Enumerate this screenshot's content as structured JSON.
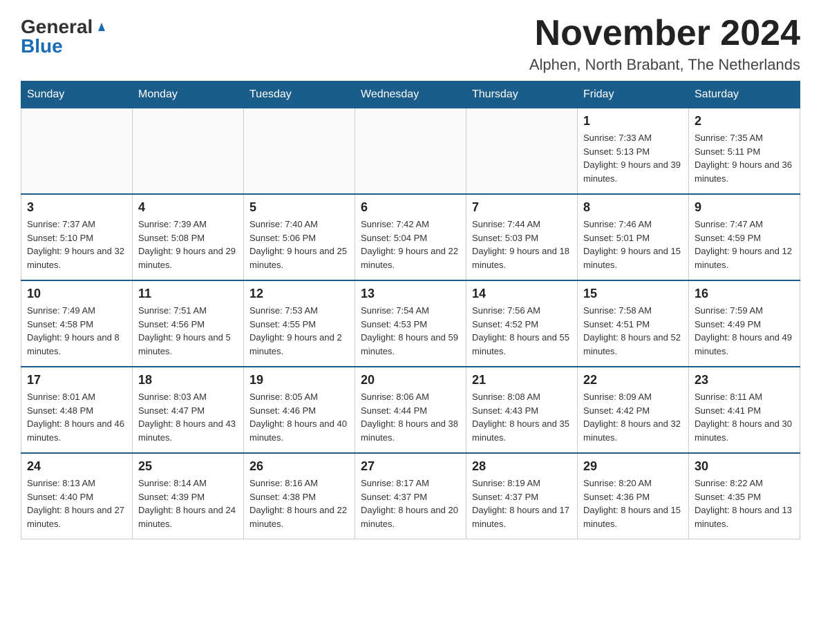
{
  "header": {
    "logo_general": "General",
    "logo_blue": "Blue",
    "month_title": "November 2024",
    "location": "Alphen, North Brabant, The Netherlands"
  },
  "days_of_week": [
    "Sunday",
    "Monday",
    "Tuesday",
    "Wednesday",
    "Thursday",
    "Friday",
    "Saturday"
  ],
  "weeks": [
    [
      {
        "day": "",
        "info": ""
      },
      {
        "day": "",
        "info": ""
      },
      {
        "day": "",
        "info": ""
      },
      {
        "day": "",
        "info": ""
      },
      {
        "day": "",
        "info": ""
      },
      {
        "day": "1",
        "info": "Sunrise: 7:33 AM\nSunset: 5:13 PM\nDaylight: 9 hours and 39 minutes."
      },
      {
        "day": "2",
        "info": "Sunrise: 7:35 AM\nSunset: 5:11 PM\nDaylight: 9 hours and 36 minutes."
      }
    ],
    [
      {
        "day": "3",
        "info": "Sunrise: 7:37 AM\nSunset: 5:10 PM\nDaylight: 9 hours and 32 minutes."
      },
      {
        "day": "4",
        "info": "Sunrise: 7:39 AM\nSunset: 5:08 PM\nDaylight: 9 hours and 29 minutes."
      },
      {
        "day": "5",
        "info": "Sunrise: 7:40 AM\nSunset: 5:06 PM\nDaylight: 9 hours and 25 minutes."
      },
      {
        "day": "6",
        "info": "Sunrise: 7:42 AM\nSunset: 5:04 PM\nDaylight: 9 hours and 22 minutes."
      },
      {
        "day": "7",
        "info": "Sunrise: 7:44 AM\nSunset: 5:03 PM\nDaylight: 9 hours and 18 minutes."
      },
      {
        "day": "8",
        "info": "Sunrise: 7:46 AM\nSunset: 5:01 PM\nDaylight: 9 hours and 15 minutes."
      },
      {
        "day": "9",
        "info": "Sunrise: 7:47 AM\nSunset: 4:59 PM\nDaylight: 9 hours and 12 minutes."
      }
    ],
    [
      {
        "day": "10",
        "info": "Sunrise: 7:49 AM\nSunset: 4:58 PM\nDaylight: 9 hours and 8 minutes."
      },
      {
        "day": "11",
        "info": "Sunrise: 7:51 AM\nSunset: 4:56 PM\nDaylight: 9 hours and 5 minutes."
      },
      {
        "day": "12",
        "info": "Sunrise: 7:53 AM\nSunset: 4:55 PM\nDaylight: 9 hours and 2 minutes."
      },
      {
        "day": "13",
        "info": "Sunrise: 7:54 AM\nSunset: 4:53 PM\nDaylight: 8 hours and 59 minutes."
      },
      {
        "day": "14",
        "info": "Sunrise: 7:56 AM\nSunset: 4:52 PM\nDaylight: 8 hours and 55 minutes."
      },
      {
        "day": "15",
        "info": "Sunrise: 7:58 AM\nSunset: 4:51 PM\nDaylight: 8 hours and 52 minutes."
      },
      {
        "day": "16",
        "info": "Sunrise: 7:59 AM\nSunset: 4:49 PM\nDaylight: 8 hours and 49 minutes."
      }
    ],
    [
      {
        "day": "17",
        "info": "Sunrise: 8:01 AM\nSunset: 4:48 PM\nDaylight: 8 hours and 46 minutes."
      },
      {
        "day": "18",
        "info": "Sunrise: 8:03 AM\nSunset: 4:47 PM\nDaylight: 8 hours and 43 minutes."
      },
      {
        "day": "19",
        "info": "Sunrise: 8:05 AM\nSunset: 4:46 PM\nDaylight: 8 hours and 40 minutes."
      },
      {
        "day": "20",
        "info": "Sunrise: 8:06 AM\nSunset: 4:44 PM\nDaylight: 8 hours and 38 minutes."
      },
      {
        "day": "21",
        "info": "Sunrise: 8:08 AM\nSunset: 4:43 PM\nDaylight: 8 hours and 35 minutes."
      },
      {
        "day": "22",
        "info": "Sunrise: 8:09 AM\nSunset: 4:42 PM\nDaylight: 8 hours and 32 minutes."
      },
      {
        "day": "23",
        "info": "Sunrise: 8:11 AM\nSunset: 4:41 PM\nDaylight: 8 hours and 30 minutes."
      }
    ],
    [
      {
        "day": "24",
        "info": "Sunrise: 8:13 AM\nSunset: 4:40 PM\nDaylight: 8 hours and 27 minutes."
      },
      {
        "day": "25",
        "info": "Sunrise: 8:14 AM\nSunset: 4:39 PM\nDaylight: 8 hours and 24 minutes."
      },
      {
        "day": "26",
        "info": "Sunrise: 8:16 AM\nSunset: 4:38 PM\nDaylight: 8 hours and 22 minutes."
      },
      {
        "day": "27",
        "info": "Sunrise: 8:17 AM\nSunset: 4:37 PM\nDaylight: 8 hours and 20 minutes."
      },
      {
        "day": "28",
        "info": "Sunrise: 8:19 AM\nSunset: 4:37 PM\nDaylight: 8 hours and 17 minutes."
      },
      {
        "day": "29",
        "info": "Sunrise: 8:20 AM\nSunset: 4:36 PM\nDaylight: 8 hours and 15 minutes."
      },
      {
        "day": "30",
        "info": "Sunrise: 8:22 AM\nSunset: 4:35 PM\nDaylight: 8 hours and 13 minutes."
      }
    ]
  ]
}
